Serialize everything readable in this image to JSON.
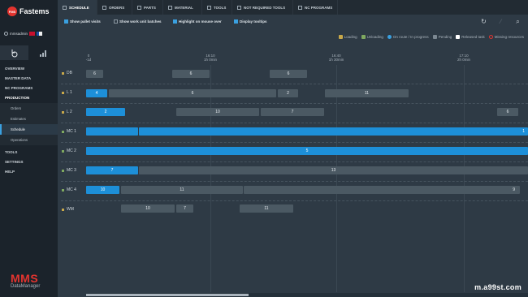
{
  "app": {
    "logo_mark": "FMS",
    "logo_text": "Fastems"
  },
  "user": {
    "name": "mmsadmin"
  },
  "brand": {
    "big": "MMS",
    "small": "DataManager"
  },
  "sidebar": {
    "items": [
      {
        "label": "Overview"
      },
      {
        "label": "Master Data"
      },
      {
        "label": "NC Programs"
      },
      {
        "label": "Production"
      }
    ],
    "subitems": [
      {
        "label": "Orders"
      },
      {
        "label": "Estimates"
      },
      {
        "label": "Schedule"
      },
      {
        "label": "Operations"
      }
    ],
    "items_after": [
      {
        "label": "Tools"
      },
      {
        "label": "Settings"
      },
      {
        "label": "Help"
      }
    ]
  },
  "tabs": [
    {
      "label": "Schedule"
    },
    {
      "label": "Orders"
    },
    {
      "label": "Parts"
    },
    {
      "label": "Material"
    },
    {
      "label": "Tools"
    },
    {
      "label": "Not required tools"
    },
    {
      "label": "NC programs"
    }
  ],
  "toolbar": {
    "checkboxes": [
      {
        "label": "Show pallet visits",
        "checked": true
      },
      {
        "label": "Show work unit batches",
        "checked": false
      },
      {
        "label": "Highlight on mouse over",
        "checked": true
      },
      {
        "label": "Display tooltips",
        "checked": true
      }
    ]
  },
  "legend": [
    {
      "label": "Loading",
      "color": "#c8a84a"
    },
    {
      "label": "Unloading",
      "color": "#7fa860"
    },
    {
      "label": "On route / In progress",
      "color": "#3aa0e0"
    },
    {
      "label": "Pending",
      "color": "#7c8892"
    },
    {
      "label": "Released task",
      "color": "#ffffff"
    },
    {
      "label": "Missing resources",
      "color": "#e3342f"
    }
  ],
  "timeline": {
    "ticks": [
      {
        "time": "0",
        "offset": "-1d"
      },
      {
        "time": "16:10",
        "offset": "1h 0min"
      },
      {
        "time": "16:40",
        "offset": "1h 30min"
      },
      {
        "time": "17:10",
        "offset": "2h 0min"
      }
    ]
  },
  "rows": [
    {
      "label": "DB",
      "bars": [
        {
          "text": "6"
        },
        {
          "text": "6"
        },
        {
          "text": "6"
        }
      ]
    },
    {
      "label": "L 1",
      "bars": [
        {
          "text": "4"
        },
        {
          "text": "6"
        },
        {
          "text": "2"
        },
        {
          "text": "11"
        }
      ]
    },
    {
      "label": "L 2",
      "bars": [
        {
          "text": "2"
        },
        {
          "text": "10"
        },
        {
          "text": "7"
        },
        {
          "text": "6"
        }
      ]
    },
    {
      "label": "MC 1",
      "bars": [
        {
          "text": ""
        },
        {
          "text": "1"
        }
      ]
    },
    {
      "label": "MC 2",
      "bars": [
        {
          "text": "5"
        }
      ]
    },
    {
      "label": "MC 3",
      "bars": [
        {
          "text": "7"
        },
        {
          "text": "13"
        }
      ]
    },
    {
      "label": "MC 4",
      "bars": [
        {
          "text": "10"
        },
        {
          "text": "11"
        },
        {
          "text": "9"
        }
      ]
    },
    {
      "label": "WM",
      "bars": [
        {
          "text": "10"
        },
        {
          "text": "7"
        },
        {
          "text": "11"
        }
      ]
    }
  ],
  "watermark": "m.a99st.com"
}
